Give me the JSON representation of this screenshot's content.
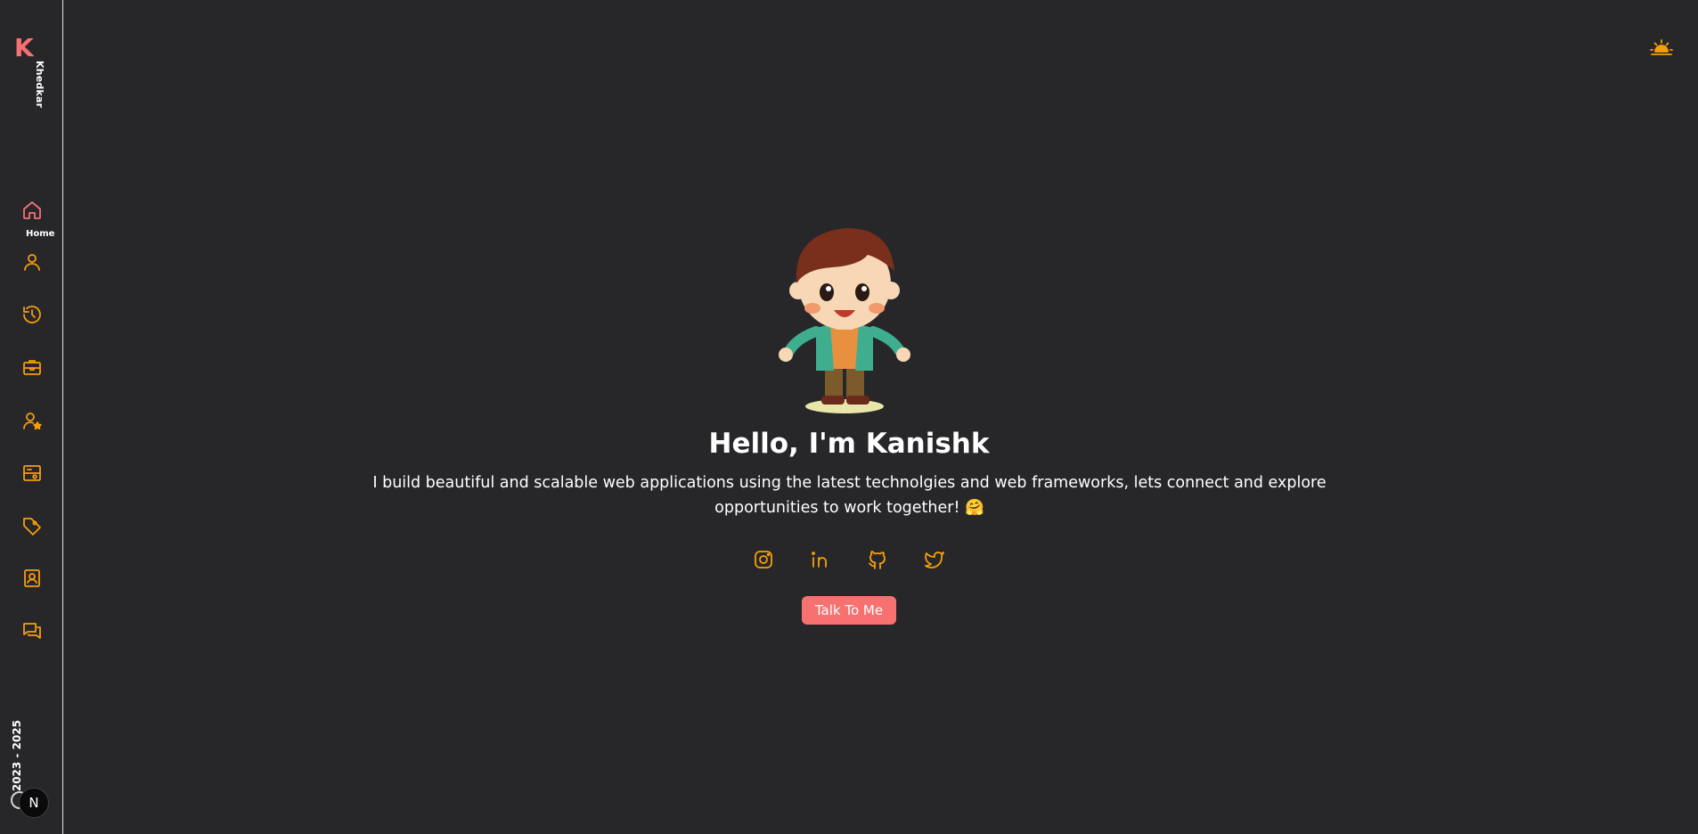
{
  "sidebar": {
    "logo": "K",
    "name": "Khedkar",
    "items": [
      {
        "icon": "home-icon",
        "label": "Home",
        "active": true
      },
      {
        "icon": "user-icon",
        "label": ""
      },
      {
        "icon": "history-icon",
        "label": ""
      },
      {
        "icon": "briefcase-icon",
        "label": ""
      },
      {
        "icon": "user-star-icon",
        "label": ""
      },
      {
        "icon": "projects-icon",
        "label": ""
      },
      {
        "icon": "tag-icon",
        "label": ""
      },
      {
        "icon": "contact-icon",
        "label": ""
      },
      {
        "icon": "chat-icon",
        "label": ""
      }
    ],
    "years": "2023 - 2025",
    "badge": "N"
  },
  "hero": {
    "title": "Hello, I'm Kanishk",
    "subtitle": "I build beautiful and scalable web applications using the latest technolgies and web frameworks, lets connect and explore opportunities to work together! 🤗",
    "socials": [
      {
        "icon": "instagram-icon"
      },
      {
        "icon": "linkedin-icon"
      },
      {
        "icon": "github-icon"
      },
      {
        "icon": "twitter-icon"
      }
    ],
    "cta_label": "Talk To Me"
  },
  "colors": {
    "background": "#27272a",
    "accent": "#f87171",
    "icon": "#f59e0b",
    "text": "#ffffff"
  }
}
